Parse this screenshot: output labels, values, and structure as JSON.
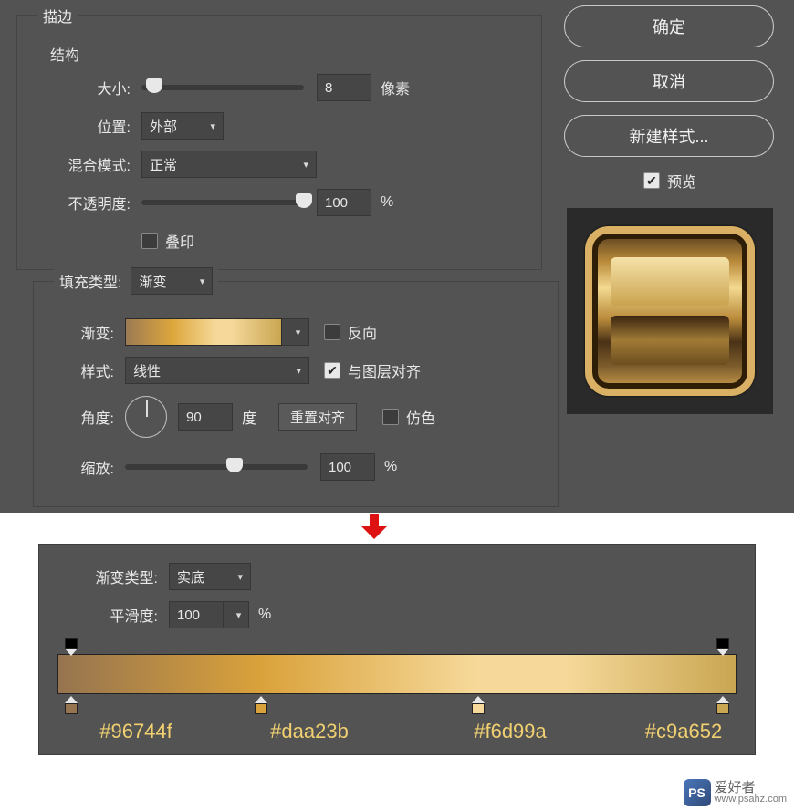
{
  "stroke": {
    "title": "描边",
    "structure_title": "结构",
    "size_label": "大小:",
    "size_value": "8",
    "size_unit": "像素",
    "position_label": "位置:",
    "position_value": "外部",
    "blend_label": "混合模式:",
    "blend_value": "正常",
    "opacity_label": "不透明度:",
    "opacity_value": "100",
    "opacity_unit": "%",
    "overprint_label": "叠印"
  },
  "fill": {
    "type_label": "填充类型:",
    "type_value": "渐变",
    "gradient_label": "渐变:",
    "reverse_label": "反向",
    "style_label": "样式:",
    "style_value": "线性",
    "align_label": "与图层对齐",
    "angle_label": "角度:",
    "angle_value": "90",
    "angle_unit": "度",
    "reset_align": "重置对齐",
    "dither_label": "仿色",
    "scale_label": "缩放:",
    "scale_value": "100",
    "scale_unit": "%"
  },
  "buttons": {
    "ok": "确定",
    "cancel": "取消",
    "new_style": "新建样式...",
    "preview": "预览"
  },
  "editor": {
    "grad_type_label": "渐变类型:",
    "grad_type_value": "实底",
    "smooth_label": "平滑度:",
    "smooth_value": "100",
    "smooth_unit": "%",
    "stops": [
      {
        "pos": 2,
        "hex": "#96744f",
        "color": "#96744f"
      },
      {
        "pos": 30,
        "hex": "#daa23b",
        "color": "#daa23b"
      },
      {
        "pos": 62,
        "hex": "#f6d99a",
        "color": "#f6d99a"
      },
      {
        "pos": 98,
        "hex": "#c9a652",
        "color": "#c9a652"
      }
    ],
    "opacity_stops": [
      2,
      98
    ]
  },
  "watermark": {
    "logo": "PS",
    "cn": "爱好者",
    "url": "www.psahz.com"
  }
}
